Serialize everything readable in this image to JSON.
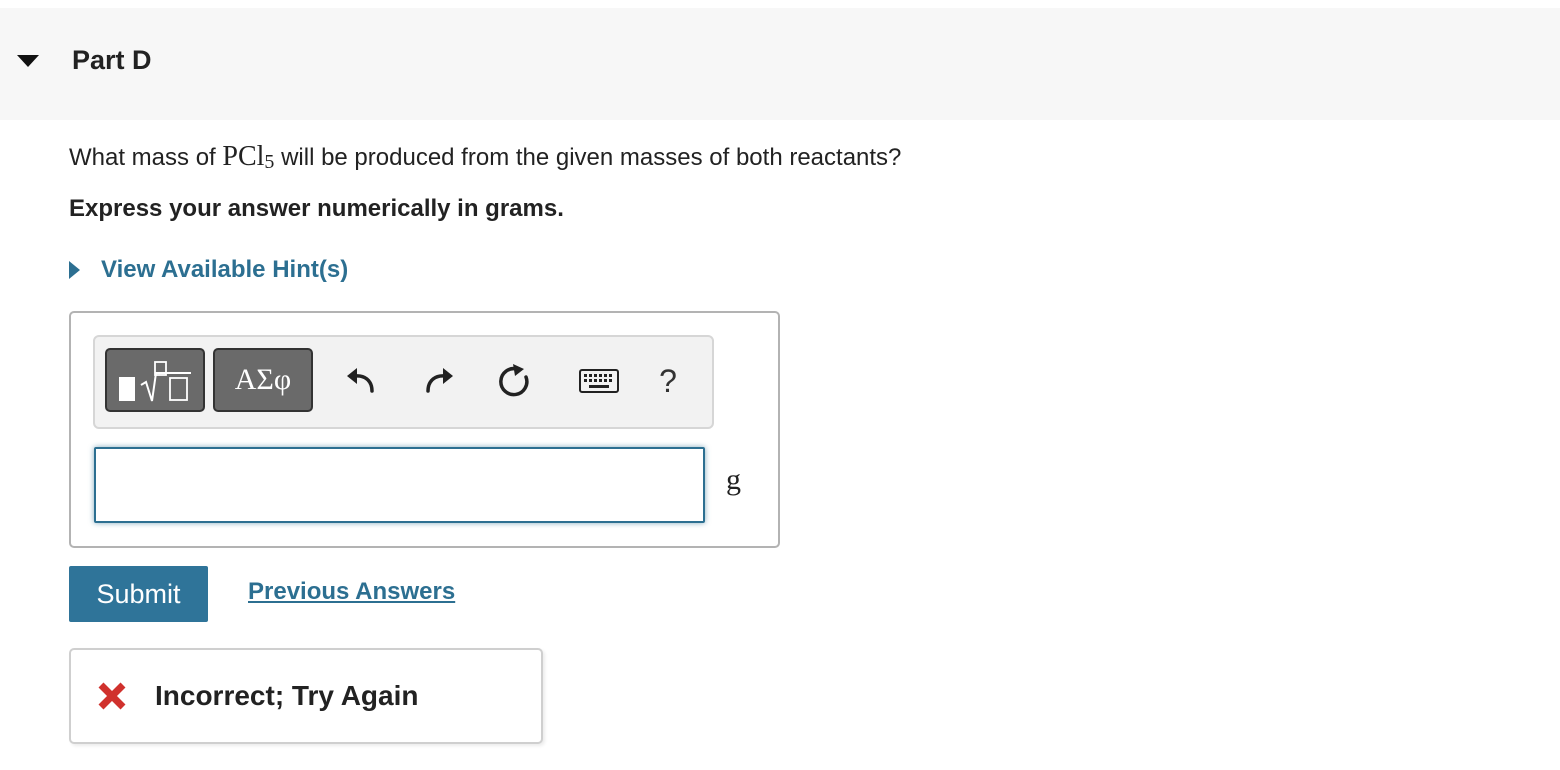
{
  "part": {
    "title": "Part D",
    "expanded": true
  },
  "question": {
    "prefix": "What mass of ",
    "formula_base": "PCl",
    "formula_subscript": "5",
    "suffix": " will be produced from the given masses of both reactants?",
    "instruction": "Express your answer numerically in grams."
  },
  "hint": {
    "label": "View Available Hint(s)"
  },
  "toolbar": {
    "templates_icon": "templates-icon",
    "symbols_label": "ΑΣφ",
    "undo_icon": "undo-icon",
    "redo_icon": "redo-icon",
    "reset_icon": "reset-icon",
    "keyboard_icon": "keyboard-icon",
    "help_label": "?"
  },
  "answer": {
    "value": "",
    "unit": "g"
  },
  "actions": {
    "submit_label": "Submit",
    "previous_answers_label": "Previous Answers"
  },
  "feedback": {
    "icon": "x-icon",
    "text": "Incorrect; Try Again",
    "color": "#d0312d"
  },
  "colors": {
    "accent": "#2c6f91",
    "submit_bg": "#2f7499",
    "header_bg": "#f7f7f7"
  }
}
